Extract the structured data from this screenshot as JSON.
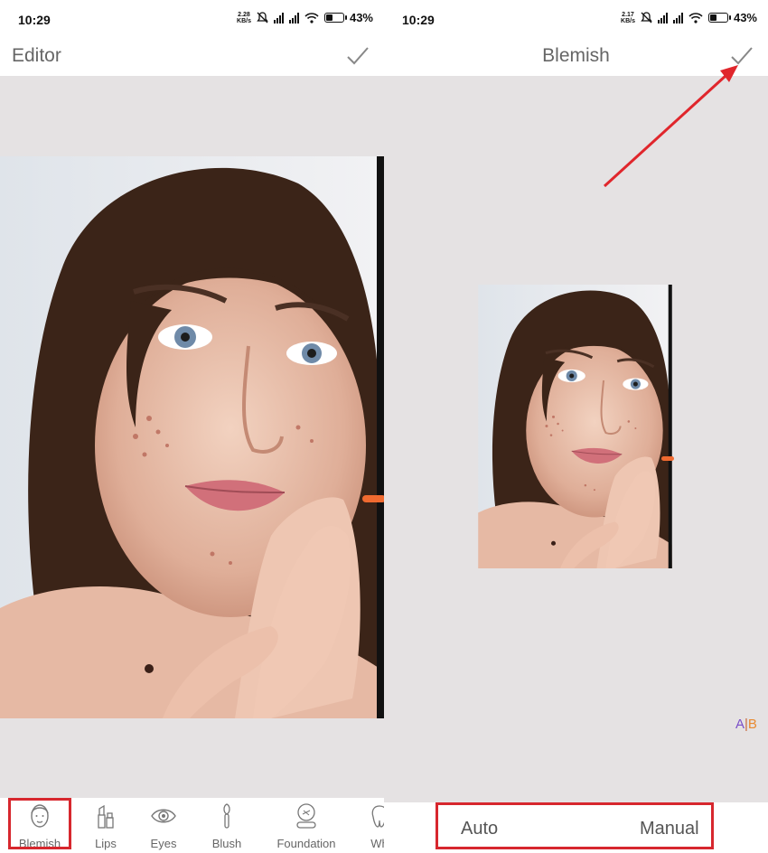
{
  "left_screen": {
    "status": {
      "time": "10:29",
      "net_speed": "2.28",
      "net_unit": "KB/s",
      "battery": "43%",
      "battery_level": 0.43
    },
    "header": {
      "title": "Editor",
      "confirm_icon": "checkmark-icon"
    },
    "toolbar": {
      "selected": "Blemish",
      "tools": [
        {
          "label": "Blemish",
          "icon": "face-icon"
        },
        {
          "label": "Lips",
          "icon": "lipstick-icon"
        },
        {
          "label": "Eyes",
          "icon": "eye-icon"
        },
        {
          "label": "Blush",
          "icon": "brush-icon"
        },
        {
          "label": "Foundation",
          "icon": "foundation-icon"
        },
        {
          "label": "Wh",
          "icon": "whiten-icon"
        }
      ]
    }
  },
  "right_screen": {
    "status": {
      "time": "10:29",
      "net_speed": "2.17",
      "net_unit": "KB/s",
      "battery": "43%",
      "battery_level": 0.43
    },
    "header": {
      "title": "Blemish",
      "confirm_icon": "checkmark-icon"
    },
    "compare": {
      "a": "A",
      "sep": "|",
      "b": "B"
    },
    "modes": {
      "auto": "Auto",
      "manual": "Manual"
    }
  },
  "colors": {
    "highlight": "#d7272e",
    "accent": "#f06a30",
    "canvas": "#e5e2e3"
  }
}
